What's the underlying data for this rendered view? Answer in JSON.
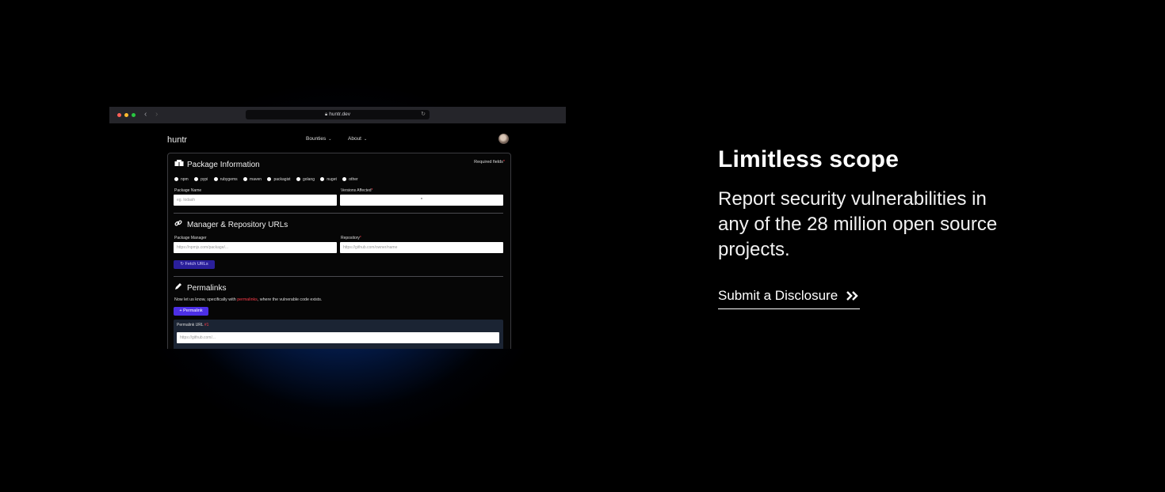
{
  "browser": {
    "url": "huntr.dev"
  },
  "site": {
    "logo": "huntr",
    "nav": [
      {
        "label": "Bounties"
      },
      {
        "label": "About"
      }
    ]
  },
  "form": {
    "required_label": "Required fields",
    "required_star": "*",
    "package_info": {
      "title": "Package Information",
      "ecosystems": [
        "npm",
        "pypi",
        "rubygems",
        "maven",
        "packagist",
        "golang",
        "nuget",
        "other"
      ],
      "package_name_label": "Package Name",
      "package_name_placeholder": "eg. lodash",
      "versions_label": "Versions Affected",
      "versions_value": "*"
    },
    "repo_urls": {
      "title": "Manager & Repository URLs",
      "manager_label": "Package Manager",
      "manager_placeholder": "https://npmjs.com/package/...",
      "repository_label": "Repository",
      "repository_placeholder": "https://github.com/owner/name",
      "fetch_button": "Fetch URLs"
    },
    "permalinks": {
      "title": "Permalinks",
      "helper_prefix": "Now let us know, specifically with ",
      "helper_highlight": "permalinks",
      "helper_suffix": ", where the vulnerable code exists.",
      "add_button": "+ Permalink",
      "url_label": "Permalink URL",
      "url_number": "#1",
      "url_placeholder": "https://github.com/..."
    }
  },
  "promo": {
    "headline": "Limitless scope",
    "body": "Report security vulnerabilities in any of the 28 million open source projects.",
    "cta": "Submit a Disclosure"
  },
  "colors": {
    "background": "#000000",
    "glow": "#0f5fdc",
    "accent_purple": "#4c2fe6",
    "required_red": "#ff3c4a"
  },
  "icons": [
    "lock-icon",
    "reload-icon",
    "boxes-icon",
    "link-icon",
    "pen-icon",
    "refresh-icon",
    "double-chevron-right-icon"
  ]
}
